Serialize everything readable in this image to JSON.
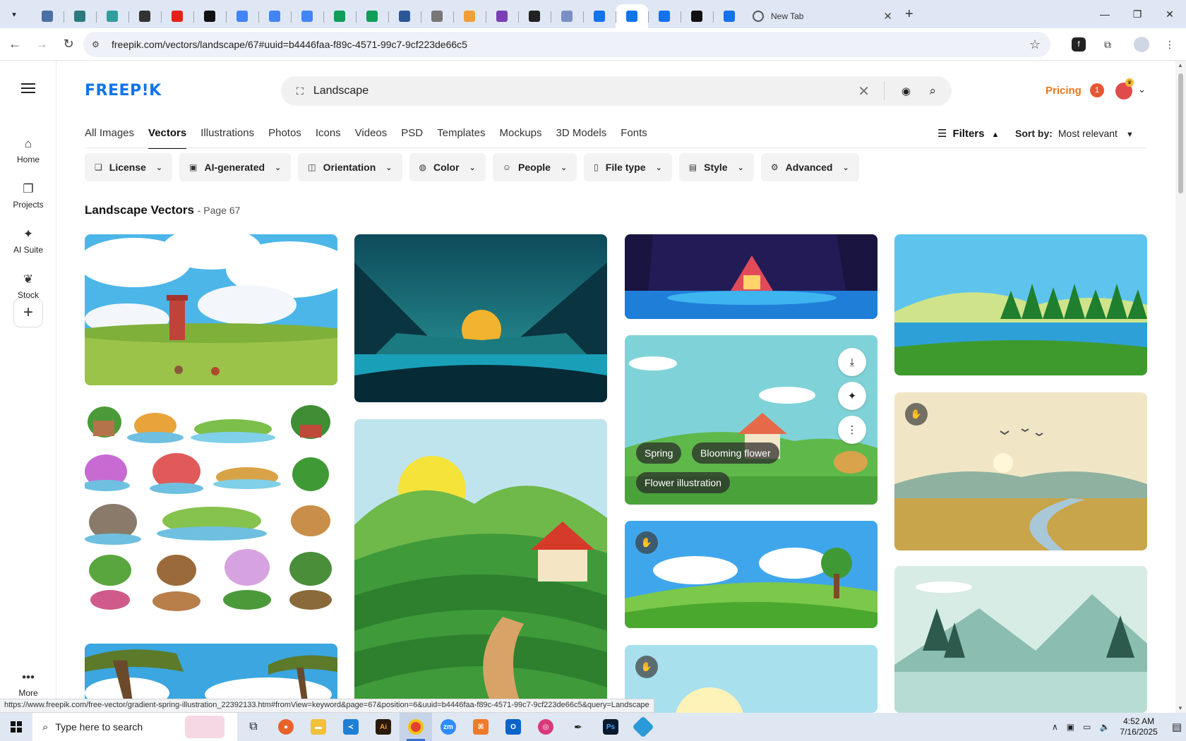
{
  "browser": {
    "tabs": [
      {
        "icon": "tab-icon-1",
        "color": "#4a6fa5"
      },
      {
        "icon": "tab-icon-2",
        "color": "#2c7a7b"
      },
      {
        "icon": "tab-icon-3",
        "color": "#2f9e9e"
      },
      {
        "icon": "tab-icon-4",
        "color": "#333333"
      },
      {
        "icon": "tab-icon-youtube",
        "color": "#e62117"
      },
      {
        "icon": "tab-icon-bolt",
        "color": "#111111"
      },
      {
        "icon": "tab-icon-docs",
        "color": "#4285f4"
      },
      {
        "icon": "tab-icon-docs",
        "color": "#4285f4"
      },
      {
        "icon": "tab-icon-docs",
        "color": "#4285f4"
      },
      {
        "icon": "tab-icon-sheets",
        "color": "#0f9d58"
      },
      {
        "icon": "tab-icon-sheets",
        "color": "#0f9d58"
      },
      {
        "icon": "tab-icon-word",
        "color": "#2b5797"
      },
      {
        "icon": "tab-icon-globe",
        "color": "#777777"
      },
      {
        "icon": "tab-icon-arrow",
        "color": "#f29e38"
      },
      {
        "icon": "tab-icon-braces",
        "color": "#7a3fb5"
      },
      {
        "icon": "tab-icon-a",
        "color": "#222222"
      },
      {
        "icon": "tab-icon-grid",
        "color": "#7b8fc7"
      },
      {
        "icon": "tab-icon-freepik",
        "color": "#1273eb"
      },
      {
        "icon": "tab-icon-freepik",
        "color": "#1273eb",
        "active": true
      },
      {
        "icon": "tab-icon-freepik",
        "color": "#1273eb"
      },
      {
        "icon": "tab-icon-m",
        "color": "#111111"
      },
      {
        "icon": "tab-icon-freepik",
        "color": "#1273eb"
      }
    ],
    "new_tab_label": "New Tab",
    "url": "freepik.com/vectors/landscape/67#uuid=b4446faa-f89c-4571-99c7-9cf223de66c5",
    "status_url": "https://www.freepik.com/free-vector/gradient-spring-illustration_22392133.htm#fromView=keyword&page=67&position=6&uuid=b4446faa-f89c-4571-99c7-9cf223de66c5&query=Landscape"
  },
  "sidebar": {
    "items": [
      {
        "label": "Home",
        "icon": "⌂"
      },
      {
        "label": "Projects",
        "icon": "❐"
      },
      {
        "label": "AI Suite",
        "icon": "✦"
      },
      {
        "label": "Stock",
        "icon": "❦"
      }
    ],
    "more_label": "More"
  },
  "header": {
    "logo": "FREEP!K",
    "search_value": "Landscape",
    "pricing": "Pricing",
    "notifications": "1"
  },
  "categories": {
    "items": [
      "All Images",
      "Vectors",
      "Illustrations",
      "Photos",
      "Icons",
      "Videos",
      "PSD",
      "Templates",
      "Mockups",
      "3D Models",
      "Fonts"
    ],
    "active": "Vectors",
    "filters_label": "Filters",
    "sort_label": "Sort by:",
    "sort_value": "Most relevant"
  },
  "chips": [
    {
      "label": "License",
      "icon": "❏"
    },
    {
      "label": "AI-generated",
      "icon": "▣"
    },
    {
      "label": "Orientation",
      "icon": "◫"
    },
    {
      "label": "Color",
      "icon": "◍"
    },
    {
      "label": "People",
      "icon": "☺"
    },
    {
      "label": "File type",
      "icon": "▯"
    },
    {
      "label": "Style",
      "icon": "▤"
    },
    {
      "label": "Advanced",
      "icon": "⚙"
    }
  ],
  "results": {
    "title": "Landscape Vectors",
    "page": "- Page 67",
    "hover_tags": [
      "Spring",
      "Blooming flower",
      "Flower illustration"
    ]
  },
  "taskbar": {
    "search_placeholder": "Type here to search",
    "time": "4:52 AM",
    "date": "7/16/2025"
  },
  "colors": {
    "brand": "#1273eb",
    "pricing": "#e8771f"
  }
}
